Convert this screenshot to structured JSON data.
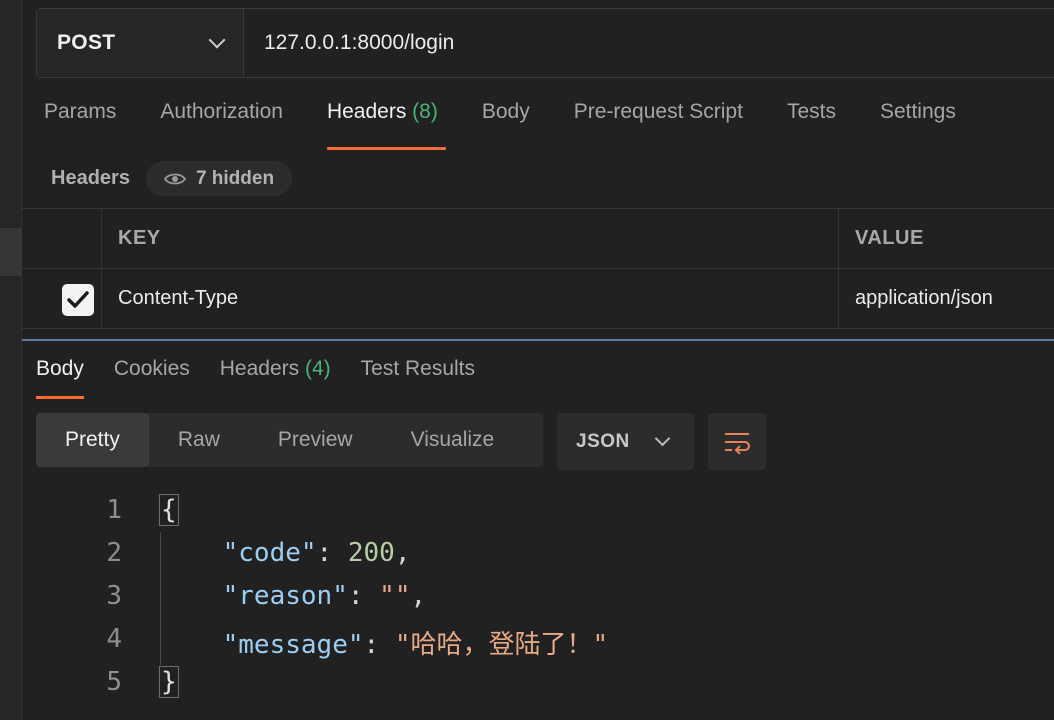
{
  "request": {
    "method": "POST",
    "url": "127.0.0.1:8000/login",
    "tabs": [
      {
        "label": "Params",
        "count": ""
      },
      {
        "label": "Authorization",
        "count": ""
      },
      {
        "label": "Headers",
        "count": "(8)"
      },
      {
        "label": "Body",
        "count": ""
      },
      {
        "label": "Pre-request Script",
        "count": ""
      },
      {
        "label": "Tests",
        "count": ""
      },
      {
        "label": "Settings",
        "count": ""
      }
    ],
    "active_tab": "Headers"
  },
  "headers_section": {
    "title": "Headers",
    "hidden_label": "7 hidden",
    "columns": {
      "key": "KEY",
      "value": "VALUE"
    },
    "rows": [
      {
        "checked": true,
        "key": "Content-Type",
        "value": "application/json"
      }
    ]
  },
  "response": {
    "tabs": [
      {
        "label": "Body",
        "count": ""
      },
      {
        "label": "Cookies",
        "count": ""
      },
      {
        "label": "Headers",
        "count": "(4)"
      },
      {
        "label": "Test Results",
        "count": ""
      }
    ],
    "active_tab": "Body",
    "views": [
      "Pretty",
      "Raw",
      "Preview",
      "Visualize"
    ],
    "active_view": "Pretty",
    "format": "JSON",
    "lines": [
      {
        "n": "1",
        "tokens": [
          {
            "t": "{",
            "c": "brace"
          }
        ]
      },
      {
        "n": "2",
        "tokens": [
          {
            "t": "    ",
            "c": "p"
          },
          {
            "t": "\"code\"",
            "c": "k"
          },
          {
            "t": ": ",
            "c": "p"
          },
          {
            "t": "200",
            "c": "n"
          },
          {
            "t": ",",
            "c": "p"
          }
        ]
      },
      {
        "n": "3",
        "tokens": [
          {
            "t": "    ",
            "c": "p"
          },
          {
            "t": "\"reason\"",
            "c": "k"
          },
          {
            "t": ": ",
            "c": "p"
          },
          {
            "t": "\"\"",
            "c": "s"
          },
          {
            "t": ",",
            "c": "p"
          }
        ]
      },
      {
        "n": "4",
        "tokens": [
          {
            "t": "    ",
            "c": "p"
          },
          {
            "t": "\"message\"",
            "c": "k"
          },
          {
            "t": ": ",
            "c": "p"
          },
          {
            "t": "\"哈哈，登陆了！\"",
            "c": "s"
          }
        ]
      },
      {
        "n": "5",
        "tokens": [
          {
            "t": "}",
            "c": "brace"
          }
        ]
      }
    ]
  },
  "colors": {
    "accent": "#ff6c37",
    "count": "#49b47a",
    "json_key": "#9ccef2",
    "json_number": "#b5cea8",
    "json_string": "#e8a987"
  },
  "icons": {
    "eye": "eye-icon",
    "wrap": "wrap-lines-icon",
    "check": "check-icon",
    "chevron": "chevron-down-icon"
  }
}
